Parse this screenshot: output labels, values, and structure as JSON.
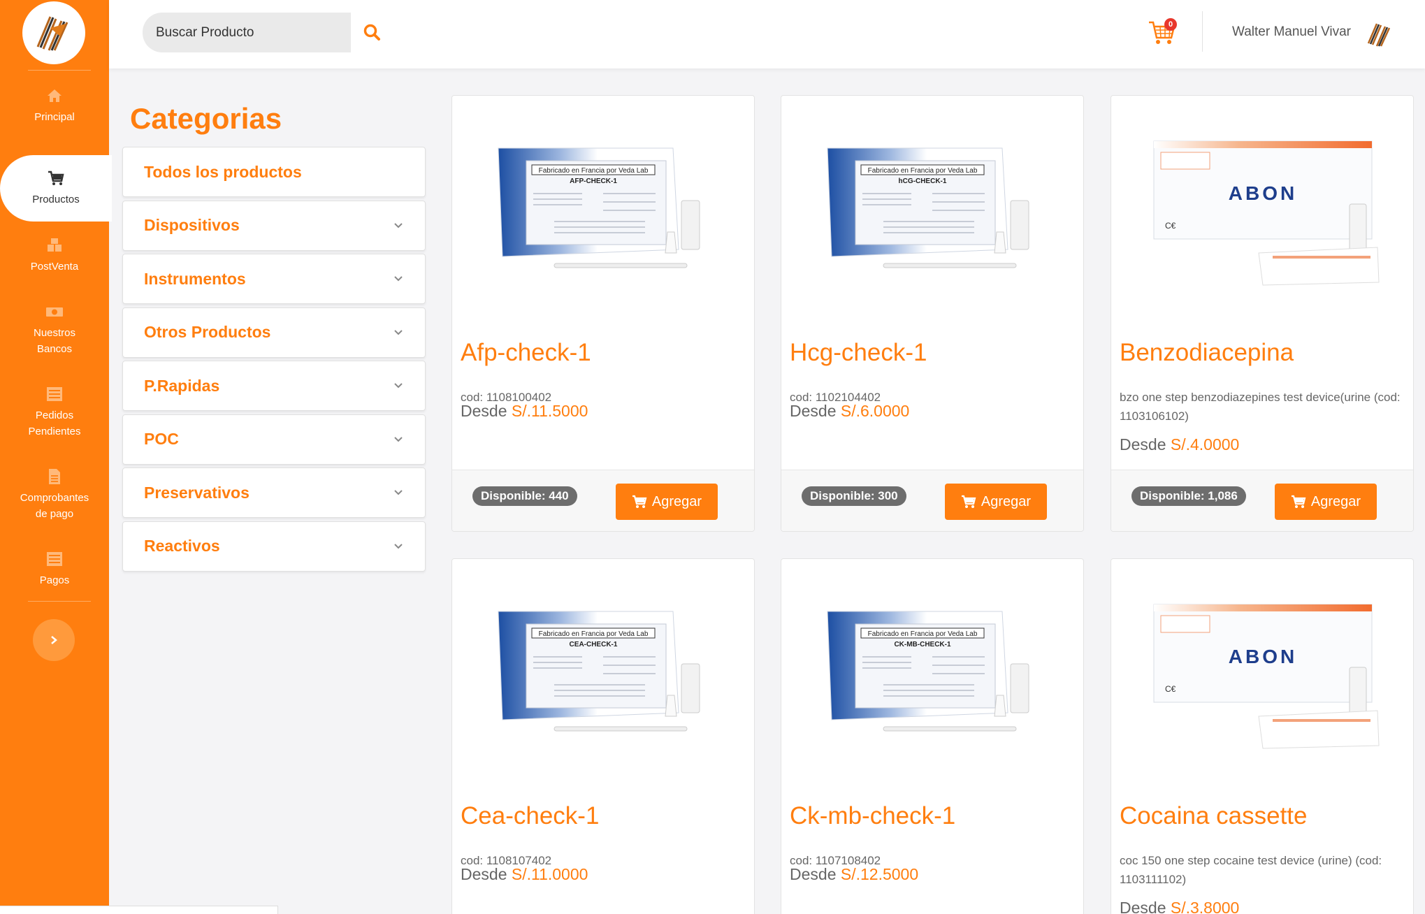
{
  "sidebar": {
    "items": [
      {
        "label": "Principal",
        "icon": "home-icon"
      },
      {
        "label": "Productos",
        "icon": "cart-icon"
      },
      {
        "label": "PostVenta",
        "icon": "boxes-icon"
      },
      {
        "label": "Nuestros\nBancos",
        "icon": "money-icon"
      },
      {
        "label": "Pedidos\nPendientes",
        "icon": "list-icon"
      },
      {
        "label": "Comprobantes\nde pago",
        "icon": "document-icon"
      },
      {
        "label": "Pagos",
        "icon": "list-icon"
      }
    ]
  },
  "header": {
    "search_placeholder": "Buscar Producto",
    "cart_count": "0",
    "user_name": "Walter Manuel Vivar"
  },
  "categories": {
    "title": "Categorias",
    "items": [
      {
        "label": "Todos los productos",
        "expandable": false
      },
      {
        "label": "Dispositivos",
        "expandable": true
      },
      {
        "label": "Instrumentos",
        "expandable": true
      },
      {
        "label": "Otros Productos",
        "expandable": true
      },
      {
        "label": "P.Rapidas",
        "expandable": true
      },
      {
        "label": "POC",
        "expandable": true
      },
      {
        "label": "Preservativos",
        "expandable": true
      },
      {
        "label": "Reactivos",
        "expandable": true
      }
    ]
  },
  "products": [
    {
      "name": "Afp-check-1",
      "desc": "cod: 1108100402",
      "price_prefix": "Desde",
      "price": "S/.11.5000",
      "stock": "Disponible: 440",
      "image_label": "AFP-CHECK-1",
      "box": "veda"
    },
    {
      "name": "Hcg-check-1",
      "desc": "cod: 1102104402",
      "price_prefix": "Desde",
      "price": "S/.6.0000",
      "stock": "Disponible: 300",
      "image_label": "hCG-CHECK-1",
      "box": "veda"
    },
    {
      "name": "Benzodiacepina",
      "desc": "bzo one step benzodiazepines test device(urine (cod: 1103106102)",
      "price_prefix": "Desde",
      "price": "S/.4.0000",
      "stock": "Disponible: 1,086",
      "image_label": "ABON",
      "box": "abon"
    },
    {
      "name": "Cea-check-1",
      "desc": "cod: 1108107402",
      "price_prefix": "Desde",
      "price": "S/.11.0000",
      "image_label": "CEA-CHECK-1",
      "box": "veda"
    },
    {
      "name": "Ck-mb-check-1",
      "desc": "cod: 1107108402",
      "price_prefix": "Desde",
      "price": "S/.12.5000",
      "image_label": "CK-MB-CHECK-1",
      "box": "veda"
    },
    {
      "name": "Cocaina cassette",
      "desc": "coc 150 one step cocaine test device (urine) (cod: 1103111102)",
      "price_prefix": "Desde",
      "price": "S/.3.8000",
      "image_label": "ABON",
      "box": "abon"
    }
  ],
  "box_text": {
    "veda_banner": "Fabricado en Francia por Veda Lab"
  },
  "add_button_label": "Agregar",
  "colors": {
    "accent": "#ff7e0f",
    "badge": "#6d6d6d",
    "cart_badge": "#e8372c"
  }
}
